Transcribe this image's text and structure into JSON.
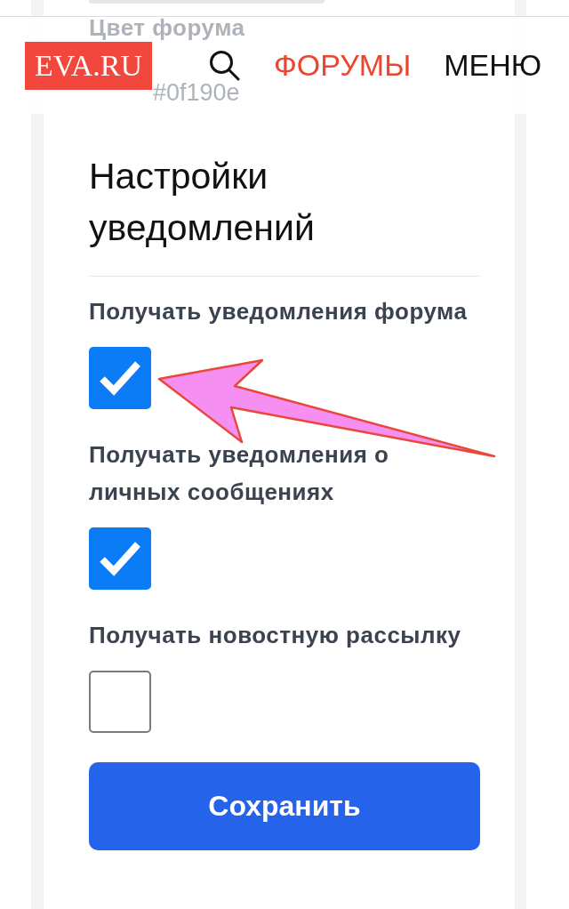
{
  "header": {
    "logo": "EVA.RU",
    "nav": [
      {
        "label": "ФОРУМЫ",
        "selected": true
      },
      {
        "label": "МЕНЮ",
        "selected": false
      }
    ]
  },
  "previous_field": {
    "label": "Цвет форума",
    "value": "#0f190e"
  },
  "section": {
    "title": "Настройки уведомлений",
    "options": [
      {
        "label": "Получать уведомления форума",
        "checked": true
      },
      {
        "label": "Получать уведомления о личных сообщениях",
        "checked": true
      },
      {
        "label": "Получать новостную рассылку",
        "checked": false
      }
    ]
  },
  "save_button": "Сохранить"
}
